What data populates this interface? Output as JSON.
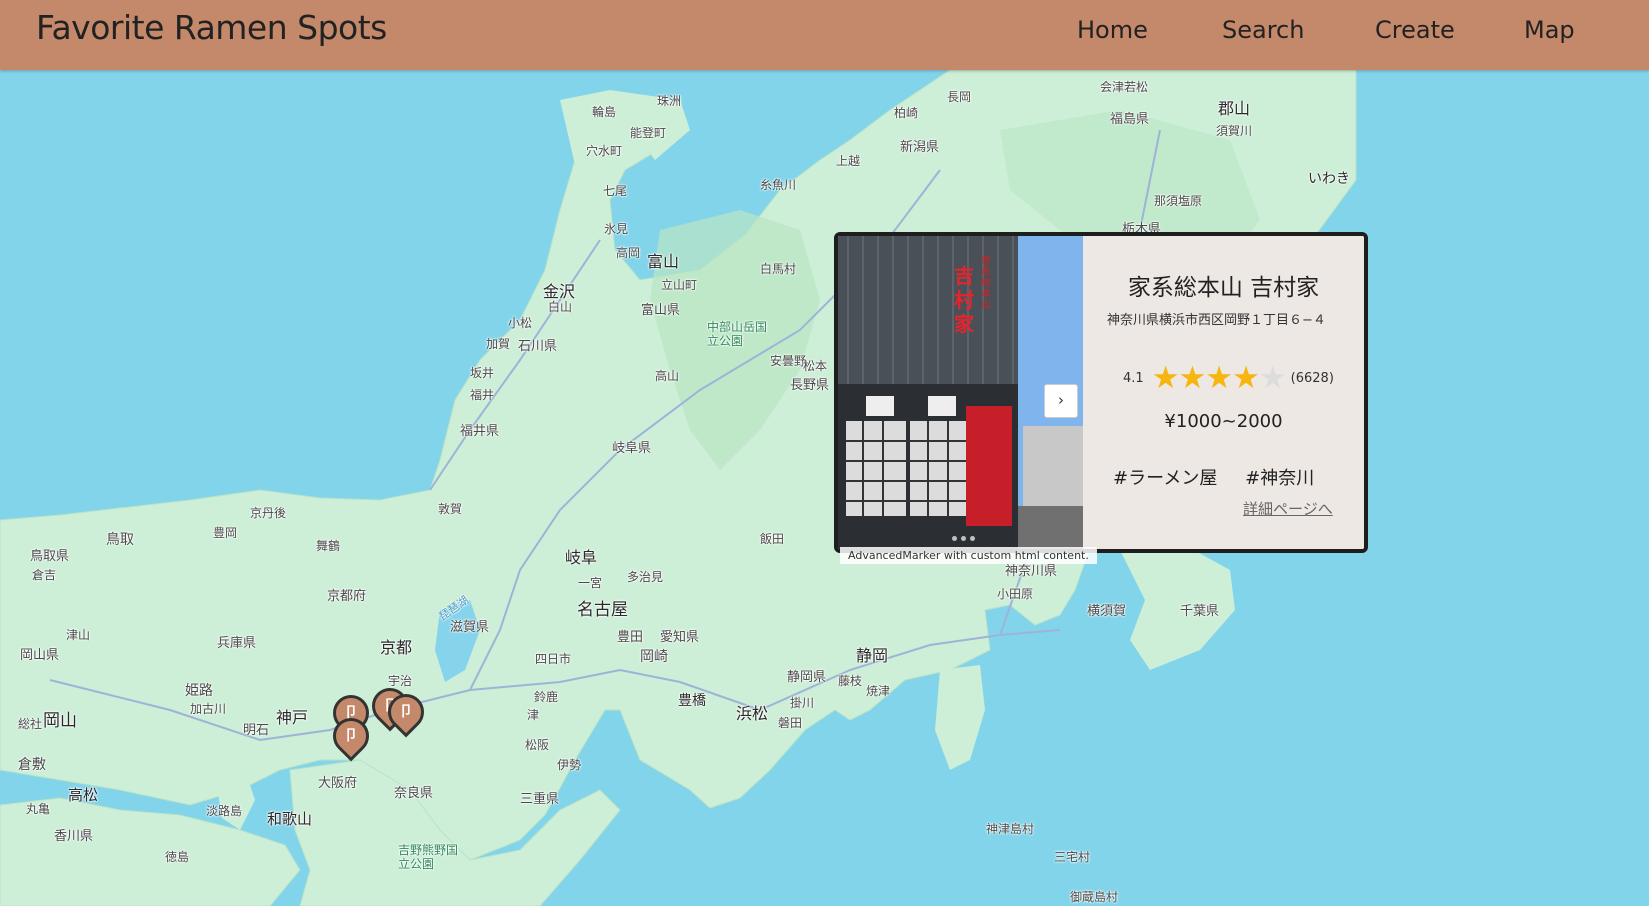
{
  "app": {
    "title": "Favorite Ramen Spots"
  },
  "nav": {
    "home": "Home",
    "search": "Search",
    "create": "Create",
    "map": "Map"
  },
  "popup": {
    "title": "家系総本山 吉村家",
    "address": "神奈川県横浜市西区岡野１丁目６−４",
    "rating": "4.1",
    "stars_filled": 4,
    "review_count": "(6628)",
    "price": "¥1000~2000",
    "tags": [
      "#ラーメン屋",
      "#神奈川"
    ],
    "detail_link": "詳細ページへ",
    "photo_sign": "吉村家",
    "photo_sign_top": "家系総本山",
    "next_button": "›"
  },
  "marker_note": "AdvancedMarker with custom html content.",
  "map_labels": {
    "cities": [
      "輪島",
      "珠洲",
      "能登町",
      "穴水町",
      "七尾",
      "氷見",
      "高岡",
      "富山",
      "立山町",
      "金沢",
      "白山",
      "小松",
      "加賀",
      "石川県",
      "富山県",
      "坂井",
      "福井",
      "福井県",
      "岐阜県",
      "白馬村",
      "安曇野",
      "松本",
      "長野県",
      "高山",
      "飯田",
      "糸魚川",
      "上越",
      "柏崎",
      "長岡",
      "新潟県",
      "会津若松",
      "郡山",
      "福島県",
      "須賀川",
      "那須塩原",
      "いわき",
      "栃木県",
      "敦賀",
      "岐阜",
      "一宮",
      "多治見",
      "名古屋",
      "豊田",
      "愛知県",
      "岡崎",
      "四日市",
      "鈴鹿",
      "津",
      "松阪",
      "伊勢",
      "三重県",
      "豊橋",
      "浜松",
      "磐田",
      "掛川",
      "静岡県",
      "藤枝",
      "焼津",
      "静岡",
      "小田原",
      "横須賀",
      "千葉県",
      "神奈川県",
      "京都",
      "京都府",
      "舞鶴",
      "豊岡",
      "京丹後",
      "鳥取",
      "鳥取県",
      "倉吉",
      "津山",
      "岡山県",
      "兵庫県",
      "姫路",
      "加古川",
      "明石",
      "神戸",
      "大阪府",
      "奈良県",
      "和歌山",
      "淡路島",
      "岡山",
      "総社",
      "倉敷",
      "高松",
      "丸亀",
      "香川県",
      "徳島",
      "宇治",
      "滋賀県",
      "中部山岳国立公園",
      "吉野熊野国立公園",
      "神津島村",
      "三宅村",
      "御蔵島村",
      "琵琶湖"
    ]
  }
}
